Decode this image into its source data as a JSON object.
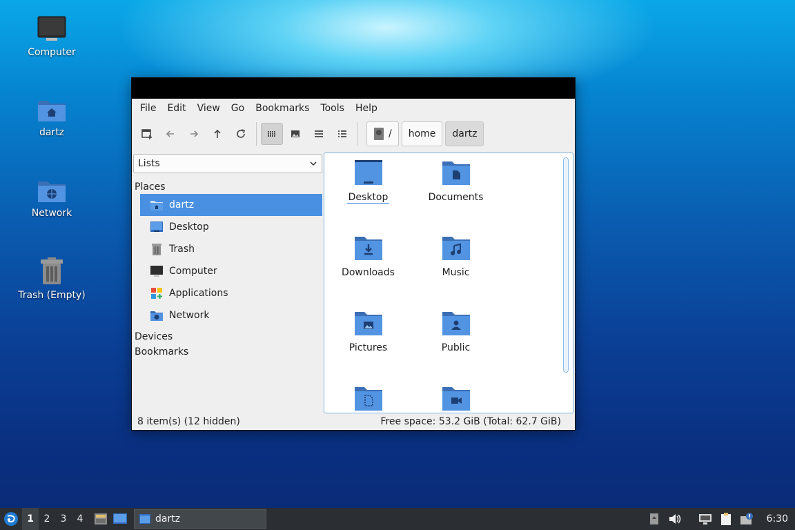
{
  "desktop": {
    "icons": [
      {
        "label": "Computer"
      },
      {
        "label": "dartz"
      },
      {
        "label": "Network"
      },
      {
        "label": "Trash (Empty)"
      }
    ]
  },
  "window": {
    "menu": [
      "File",
      "Edit",
      "View",
      "Go",
      "Bookmarks",
      "Tools",
      "Help"
    ],
    "path": {
      "root": "/",
      "crumbs": [
        "home",
        "dartz"
      ]
    },
    "sidebar": {
      "mode": "Lists",
      "places_label": "Places",
      "places": [
        {
          "label": "dartz",
          "icon": "home-folder-icon",
          "selected": true
        },
        {
          "label": "Desktop",
          "icon": "desktop-icon"
        },
        {
          "label": "Trash",
          "icon": "trash-icon"
        },
        {
          "label": "Computer",
          "icon": "computer-icon"
        },
        {
          "label": "Applications",
          "icon": "applications-icon"
        },
        {
          "label": "Network",
          "icon": "network-icon"
        }
      ],
      "devices_label": "Devices",
      "bookmarks_label": "Bookmarks"
    },
    "files": [
      {
        "label": "Desktop",
        "icon": "desktop-folder-icon"
      },
      {
        "label": "Documents",
        "icon": "documents-folder-icon"
      },
      {
        "label": "Downloads",
        "icon": "downloads-folder-icon"
      },
      {
        "label": "Music",
        "icon": "music-folder-icon"
      },
      {
        "label": "Pictures",
        "icon": "pictures-folder-icon"
      },
      {
        "label": "Public",
        "icon": "public-folder-icon"
      },
      {
        "label": "",
        "icon": "templates-folder-icon"
      },
      {
        "label": "",
        "icon": "videos-folder-icon"
      }
    ],
    "status": {
      "items": "8 item(s) (12 hidden)",
      "space": "Free space: 53.2 GiB (Total: 62.7 GiB)"
    }
  },
  "taskbar": {
    "workspaces": [
      "1",
      "2",
      "3",
      "4"
    ],
    "task_label": "dartz",
    "clock": "6:30"
  },
  "colors": {
    "accent": "#4a90e2",
    "folder": "#5294e2",
    "folder_dark": "#3b6fb5"
  }
}
